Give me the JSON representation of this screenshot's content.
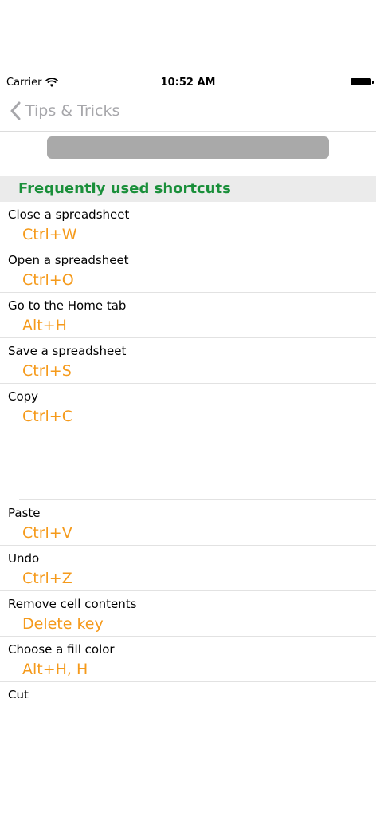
{
  "status_bar": {
    "carrier": "Carrier",
    "time": "10:52 AM"
  },
  "nav": {
    "back_label": "Tips & Tricks"
  },
  "section": {
    "title": "Frequently used shortcuts"
  },
  "rows": [
    {
      "label": "Close a spreadsheet",
      "shortcut": "Ctrl+W"
    },
    {
      "label": "Open a spreadsheet",
      "shortcut": "Ctrl+O"
    },
    {
      "label": "Go to the Home tab",
      "shortcut": "Alt+H"
    },
    {
      "label": "Save a spreadsheet",
      "shortcut": "Ctrl+S"
    },
    {
      "label": "Copy",
      "shortcut": "Ctrl+C"
    },
    {
      "label": "Paste",
      "shortcut": "Ctrl+V"
    },
    {
      "label": "Undo",
      "shortcut": "Ctrl+Z"
    },
    {
      "label": "Remove cell contents",
      "shortcut": "Delete key"
    },
    {
      "label": "Choose a fill color",
      "shortcut": "Alt+H, H"
    },
    {
      "label": "Cut"
    }
  ],
  "colors": {
    "section_title": "#1a8f3a",
    "shortcut": "#f59a1b",
    "back": "#a7a7ab",
    "placeholder_bar": "#a9a9a9"
  }
}
